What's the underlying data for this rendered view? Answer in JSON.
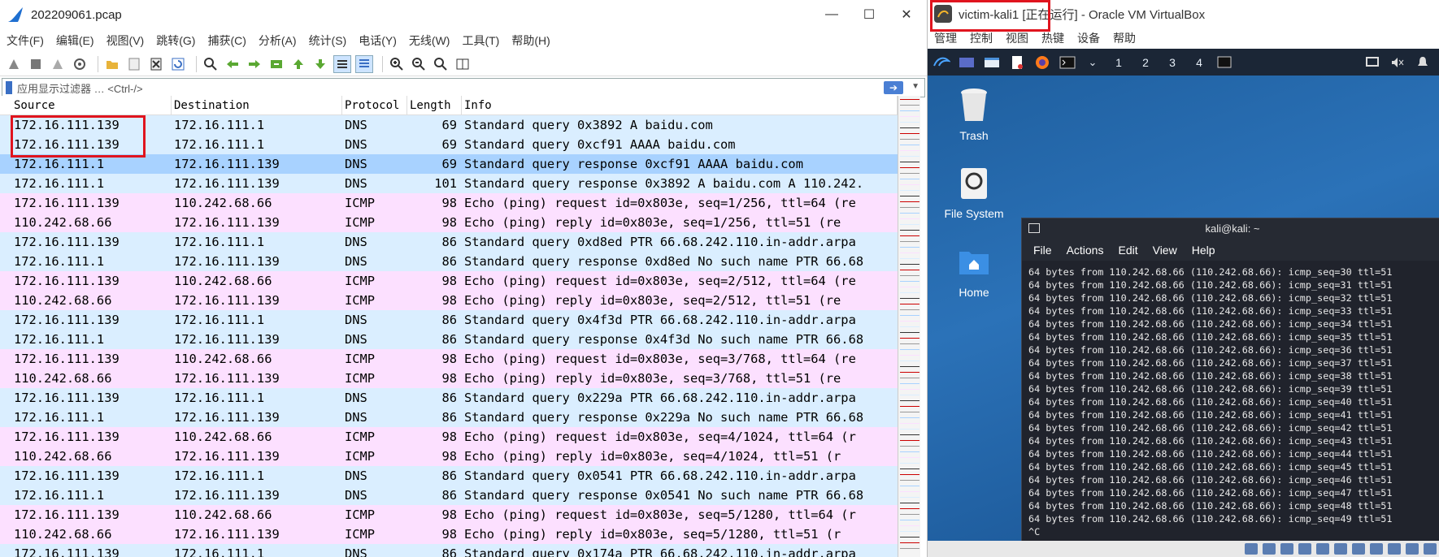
{
  "wireshark": {
    "title": "202209061.pcap",
    "window_buttons": [
      "—",
      "☐",
      "✕"
    ],
    "menu": [
      "文件(F)",
      "编辑(E)",
      "视图(V)",
      "跳转(G)",
      "捕获(C)",
      "分析(A)",
      "统计(S)",
      "电话(Y)",
      "无线(W)",
      "工具(T)",
      "帮助(H)"
    ],
    "filter_placeholder": "应用显示过滤器 … <Ctrl-/>",
    "columns": [
      "Source",
      "Destination",
      "Protocol",
      "Length",
      "Info"
    ],
    "packets": [
      {
        "src": "172.16.111.139",
        "dst": "172.16.111.1",
        "proto": "DNS",
        "len": "69",
        "info": "Standard query 0x3892 A baidu.com",
        "kind": "dns"
      },
      {
        "src": "172.16.111.139",
        "dst": "172.16.111.1",
        "proto": "DNS",
        "len": "69",
        "info": "Standard query 0xcf91 AAAA baidu.com",
        "kind": "dns"
      },
      {
        "src": "172.16.111.1",
        "dst": "172.16.111.139",
        "proto": "DNS",
        "len": "69",
        "info": "Standard query response 0xcf91 AAAA baidu.com",
        "kind": "sel"
      },
      {
        "src": "172.16.111.1",
        "dst": "172.16.111.139",
        "proto": "DNS",
        "len": "101",
        "info": "Standard query response 0x3892 A baidu.com A 110.242.",
        "kind": "dns"
      },
      {
        "src": "172.16.111.139",
        "dst": "110.242.68.66",
        "proto": "ICMP",
        "len": "98",
        "info": "Echo (ping) request  id=0x803e, seq=1/256, ttl=64 (re",
        "kind": "icmp"
      },
      {
        "src": "110.242.68.66",
        "dst": "172.16.111.139",
        "proto": "ICMP",
        "len": "98",
        "info": "Echo (ping) reply    id=0x803e, seq=1/256, ttl=51 (re",
        "kind": "icmp"
      },
      {
        "src": "172.16.111.139",
        "dst": "172.16.111.1",
        "proto": "DNS",
        "len": "86",
        "info": "Standard query 0xd8ed PTR 66.68.242.110.in-addr.arpa",
        "kind": "dns"
      },
      {
        "src": "172.16.111.1",
        "dst": "172.16.111.139",
        "proto": "DNS",
        "len": "86",
        "info": "Standard query response 0xd8ed No such name PTR 66.68",
        "kind": "dns"
      },
      {
        "src": "172.16.111.139",
        "dst": "110.242.68.66",
        "proto": "ICMP",
        "len": "98",
        "info": "Echo (ping) request  id=0x803e, seq=2/512, ttl=64 (re",
        "kind": "icmp"
      },
      {
        "src": "110.242.68.66",
        "dst": "172.16.111.139",
        "proto": "ICMP",
        "len": "98",
        "info": "Echo (ping) reply    id=0x803e, seq=2/512, ttl=51 (re",
        "kind": "icmp"
      },
      {
        "src": "172.16.111.139",
        "dst": "172.16.111.1",
        "proto": "DNS",
        "len": "86",
        "info": "Standard query 0x4f3d PTR 66.68.242.110.in-addr.arpa",
        "kind": "dns"
      },
      {
        "src": "172.16.111.1",
        "dst": "172.16.111.139",
        "proto": "DNS",
        "len": "86",
        "info": "Standard query response 0x4f3d No such name PTR 66.68",
        "kind": "dns"
      },
      {
        "src": "172.16.111.139",
        "dst": "110.242.68.66",
        "proto": "ICMP",
        "len": "98",
        "info": "Echo (ping) request  id=0x803e, seq=3/768, ttl=64 (re",
        "kind": "icmp"
      },
      {
        "src": "110.242.68.66",
        "dst": "172.16.111.139",
        "proto": "ICMP",
        "len": "98",
        "info": "Echo (ping) reply    id=0x803e, seq=3/768, ttl=51 (re",
        "kind": "icmp"
      },
      {
        "src": "172.16.111.139",
        "dst": "172.16.111.1",
        "proto": "DNS",
        "len": "86",
        "info": "Standard query 0x229a PTR 66.68.242.110.in-addr.arpa",
        "kind": "dns"
      },
      {
        "src": "172.16.111.1",
        "dst": "172.16.111.139",
        "proto": "DNS",
        "len": "86",
        "info": "Standard query response 0x229a No such name PTR 66.68",
        "kind": "dns"
      },
      {
        "src": "172.16.111.139",
        "dst": "110.242.68.66",
        "proto": "ICMP",
        "len": "98",
        "info": "Echo (ping) request  id=0x803e, seq=4/1024, ttl=64 (r",
        "kind": "icmp"
      },
      {
        "src": "110.242.68.66",
        "dst": "172.16.111.139",
        "proto": "ICMP",
        "len": "98",
        "info": "Echo (ping) reply    id=0x803e, seq=4/1024, ttl=51 (r",
        "kind": "icmp"
      },
      {
        "src": "172.16.111.139",
        "dst": "172.16.111.1",
        "proto": "DNS",
        "len": "86",
        "info": "Standard query 0x0541 PTR 66.68.242.110.in-addr.arpa",
        "kind": "dns"
      },
      {
        "src": "172.16.111.1",
        "dst": "172.16.111.139",
        "proto": "DNS",
        "len": "86",
        "info": "Standard query response 0x0541 No such name PTR 66.68",
        "kind": "dns"
      },
      {
        "src": "172.16.111.139",
        "dst": "110.242.68.66",
        "proto": "ICMP",
        "len": "98",
        "info": "Echo (ping) request  id=0x803e, seq=5/1280, ttl=64 (r",
        "kind": "icmp"
      },
      {
        "src": "110.242.68.66",
        "dst": "172.16.111.139",
        "proto": "ICMP",
        "len": "98",
        "info": "Echo (ping) reply    id=0x803e, seq=5/1280, ttl=51 (r",
        "kind": "icmp"
      },
      {
        "src": "172.16.111.139",
        "dst": "172.16.111.1",
        "proto": "DNS",
        "len": "86",
        "info": "Standard query 0x174a PTR 66.68.242.110.in-addr.arpa",
        "kind": "dns"
      }
    ],
    "colors": {
      "dns": "#daeeff",
      "icmp": "#fce0ff",
      "selected": "#a8d2ff",
      "highlight": "#e0141e"
    }
  },
  "virtualbox": {
    "title": "victim-kali1 [正在运行] - Oracle VM VirtualBox",
    "menu": [
      "管理",
      "控制",
      "视图",
      "热键",
      "设备",
      "帮助"
    ],
    "workspaces": [
      "1",
      "2",
      "3",
      "4"
    ],
    "desktop_icons": [
      "Trash",
      "File System",
      "Home"
    ],
    "terminal": {
      "title": "kali@kali: ~",
      "menu": [
        "File",
        "Actions",
        "Edit",
        "View",
        "Help"
      ],
      "lines": [
        "64 bytes from 110.242.68.66 (110.242.68.66): icmp_seq=30 ttl=51",
        "64 bytes from 110.242.68.66 (110.242.68.66): icmp_seq=31 ttl=51",
        "64 bytes from 110.242.68.66 (110.242.68.66): icmp_seq=32 ttl=51",
        "64 bytes from 110.242.68.66 (110.242.68.66): icmp_seq=33 ttl=51",
        "64 bytes from 110.242.68.66 (110.242.68.66): icmp_seq=34 ttl=51",
        "64 bytes from 110.242.68.66 (110.242.68.66): icmp_seq=35 ttl=51",
        "64 bytes from 110.242.68.66 (110.242.68.66): icmp_seq=36 ttl=51",
        "64 bytes from 110.242.68.66 (110.242.68.66): icmp_seq=37 ttl=51",
        "64 bytes from 110.242.68.66 (110.242.68.66): icmp_seq=38 ttl=51",
        "64 bytes from 110.242.68.66 (110.242.68.66): icmp_seq=39 ttl=51",
        "64 bytes from 110.242.68.66 (110.242.68.66): icmp_seq=40 ttl=51",
        "64 bytes from 110.242.68.66 (110.242.68.66): icmp_seq=41 ttl=51",
        "64 bytes from 110.242.68.66 (110.242.68.66): icmp_seq=42 ttl=51",
        "64 bytes from 110.242.68.66 (110.242.68.66): icmp_seq=43 ttl=51",
        "64 bytes from 110.242.68.66 (110.242.68.66): icmp_seq=44 ttl=51",
        "64 bytes from 110.242.68.66 (110.242.68.66): icmp_seq=45 ttl=51",
        "64 bytes from 110.242.68.66 (110.242.68.66): icmp_seq=46 ttl=51",
        "64 bytes from 110.242.68.66 (110.242.68.66): icmp_seq=47 ttl=51",
        "64 bytes from 110.242.68.66 (110.242.68.66): icmp_seq=48 ttl=51",
        "64 bytes from 110.242.68.66 (110.242.68.66): icmp_seq=49 ttl=51",
        "^C"
      ]
    }
  }
}
